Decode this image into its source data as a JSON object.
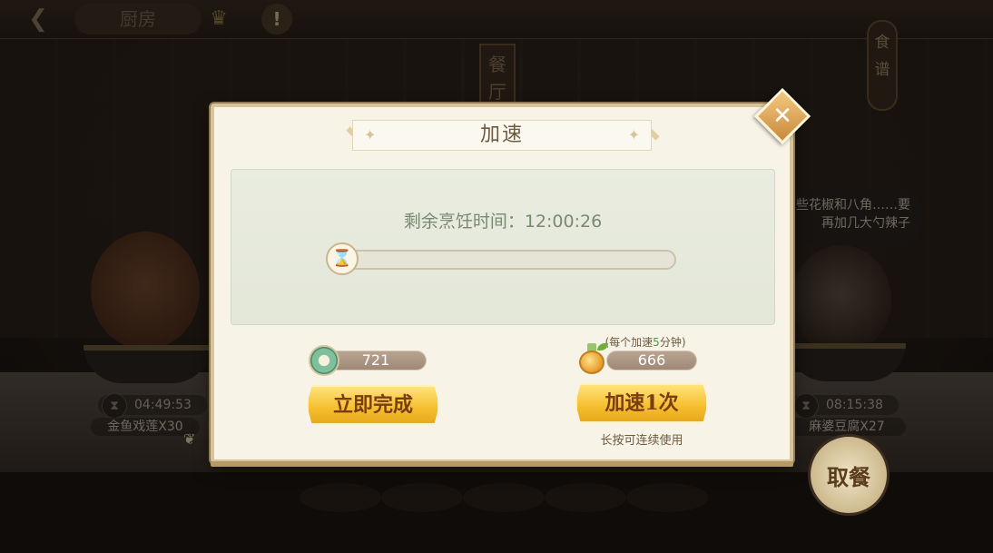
{
  "topbar": {
    "back_icon": "back-arrow-icon",
    "kitchen_label": "厨房",
    "crown_icon": "crown-icon",
    "alert_icon": "alert-icon",
    "alert_glyph": "!"
  },
  "scene": {
    "restaurant_sign": "餐厅",
    "recipe_sign": "食谱",
    "speech_text": "些花椒和八角……要再加几大勺辣子",
    "left_station": {
      "timer": "04:49:53",
      "dish": "金鱼戏莲X30"
    },
    "right_station": {
      "timer": "08:15:38",
      "dish": "麻婆豆腐X27"
    },
    "pickup_label": "取餐"
  },
  "dialog": {
    "title": "加速",
    "close_icon": "close-icon",
    "remaining_label": "剩余烹饪时间：",
    "remaining_time": "12:00:26",
    "progress_fraction": 0.0,
    "instant": {
      "currency_icon": "jade-coin-icon",
      "cost": "721",
      "button_label": "立即完成"
    },
    "speedup": {
      "note_prefix": "(每个加速",
      "note_value": "5",
      "note_suffix": "分钟)",
      "item_icon": "potion-icon",
      "count": "666",
      "button_label": "加速1次",
      "hint": "长按可连续使用"
    }
  },
  "colors": {
    "dialog_bg": "#f7f3e6",
    "accent_gold": "#f5be2e",
    "button_text": "#7a3d12",
    "panel_bg": "#e6e9dc",
    "timer_text": "#7a8a70",
    "highlight_green": "#4f9a44"
  }
}
